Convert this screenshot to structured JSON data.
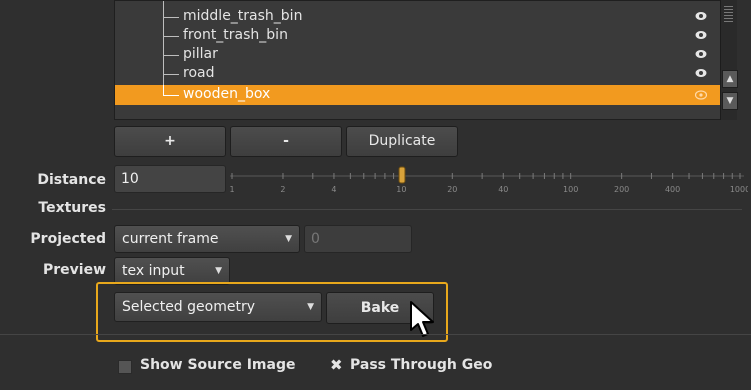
{
  "geometry_list": {
    "items": [
      {
        "label": "middle_trash_bin",
        "selected": false
      },
      {
        "label": "front_trash_bin",
        "selected": false
      },
      {
        "label": "pillar",
        "selected": false
      },
      {
        "label": "road",
        "selected": false
      },
      {
        "label": "wooden_box",
        "selected": true
      }
    ]
  },
  "list_buttons": {
    "add": "+",
    "remove": "-",
    "duplicate": "Duplicate"
  },
  "distance": {
    "label": "Distance",
    "value": "10",
    "slider_ticks": [
      "1",
      "2",
      "4",
      "10",
      "20",
      "40",
      "100",
      "200",
      "400",
      "1000"
    ]
  },
  "textures": {
    "label": "Textures"
  },
  "projected": {
    "label": "Projected",
    "value": "current frame",
    "frame": "0"
  },
  "preview": {
    "label": "Preview",
    "value": "tex input"
  },
  "bake": {
    "mode": "Selected geometry",
    "button": "Bake"
  },
  "options": {
    "show_source_image": "Show Source Image",
    "pass_through_geo": "Pass Through Geo"
  },
  "colors": {
    "accent": "#f29a1f",
    "highlight_frame": "#e8a81c",
    "background": "#2f2f2f"
  }
}
